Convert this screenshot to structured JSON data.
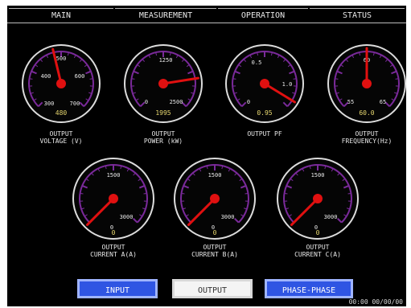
{
  "tabs": [
    {
      "label": "MAIN",
      "active": false
    },
    {
      "label": "MEASUREMENT",
      "active": true
    },
    {
      "label": "OPERATION",
      "active": false
    },
    {
      "label": "STATUS",
      "active": false
    }
  ],
  "gauges": [
    {
      "id": "voltage",
      "label_line1": "OUTPUT",
      "label_line2": "VOLTAGE (V)",
      "ticks": [
        "400",
        "500",
        "600",
        "300",
        "700"
      ],
      "readout": "480",
      "needle_level": 0.45
    },
    {
      "id": "power",
      "label_line1": "OUTPUT",
      "label_line2": "POWER (kW)",
      "ticks": [
        "1250",
        "0",
        "2500"
      ],
      "readout": "1995",
      "needle_level": 0.8
    },
    {
      "id": "pf",
      "label_line1": "OUTPUT PF",
      "label_line2": "",
      "ticks": [
        "0.5",
        "1.0",
        "0"
      ],
      "readout": "0.95",
      "needle_level": 0.95
    },
    {
      "id": "frequency",
      "label_line1": "OUTPUT",
      "label_line2": "FREQUENCY(Hz)",
      "ticks": [
        "60",
        "55",
        "65"
      ],
      "readout": "60.0",
      "needle_level": 0.5
    },
    {
      "id": "current_a",
      "label_line1": "OUTPUT",
      "label_line2": "CURRENT A(A)",
      "ticks": [
        "1500",
        "3000",
        "0"
      ],
      "readout": "0",
      "needle_level": 0.0
    },
    {
      "id": "current_b",
      "label_line1": "OUTPUT",
      "label_line2": "CURRENT B(A)",
      "ticks": [
        "1500",
        "3000",
        "0"
      ],
      "readout": "0",
      "needle_level": 0.0
    },
    {
      "id": "current_c",
      "label_line1": "OUTPUT",
      "label_line2": "CURRENT C(A)",
      "ticks": [
        "1500",
        "3000",
        "0"
      ],
      "readout": "0",
      "needle_level": 0.0
    }
  ],
  "buttons": [
    {
      "label": "INPUT",
      "style": "blue"
    },
    {
      "label": "OUTPUT",
      "style": "white"
    },
    {
      "label": "PHASE-PHASE",
      "style": "blue"
    }
  ],
  "clock": "00:00  00/00/00",
  "colors": {
    "dial_ring": "#7a2a9a",
    "needle": "#e01010",
    "readout": "#e8d870",
    "label": "#e8e8e8",
    "button_blue": "#2f55e3"
  }
}
